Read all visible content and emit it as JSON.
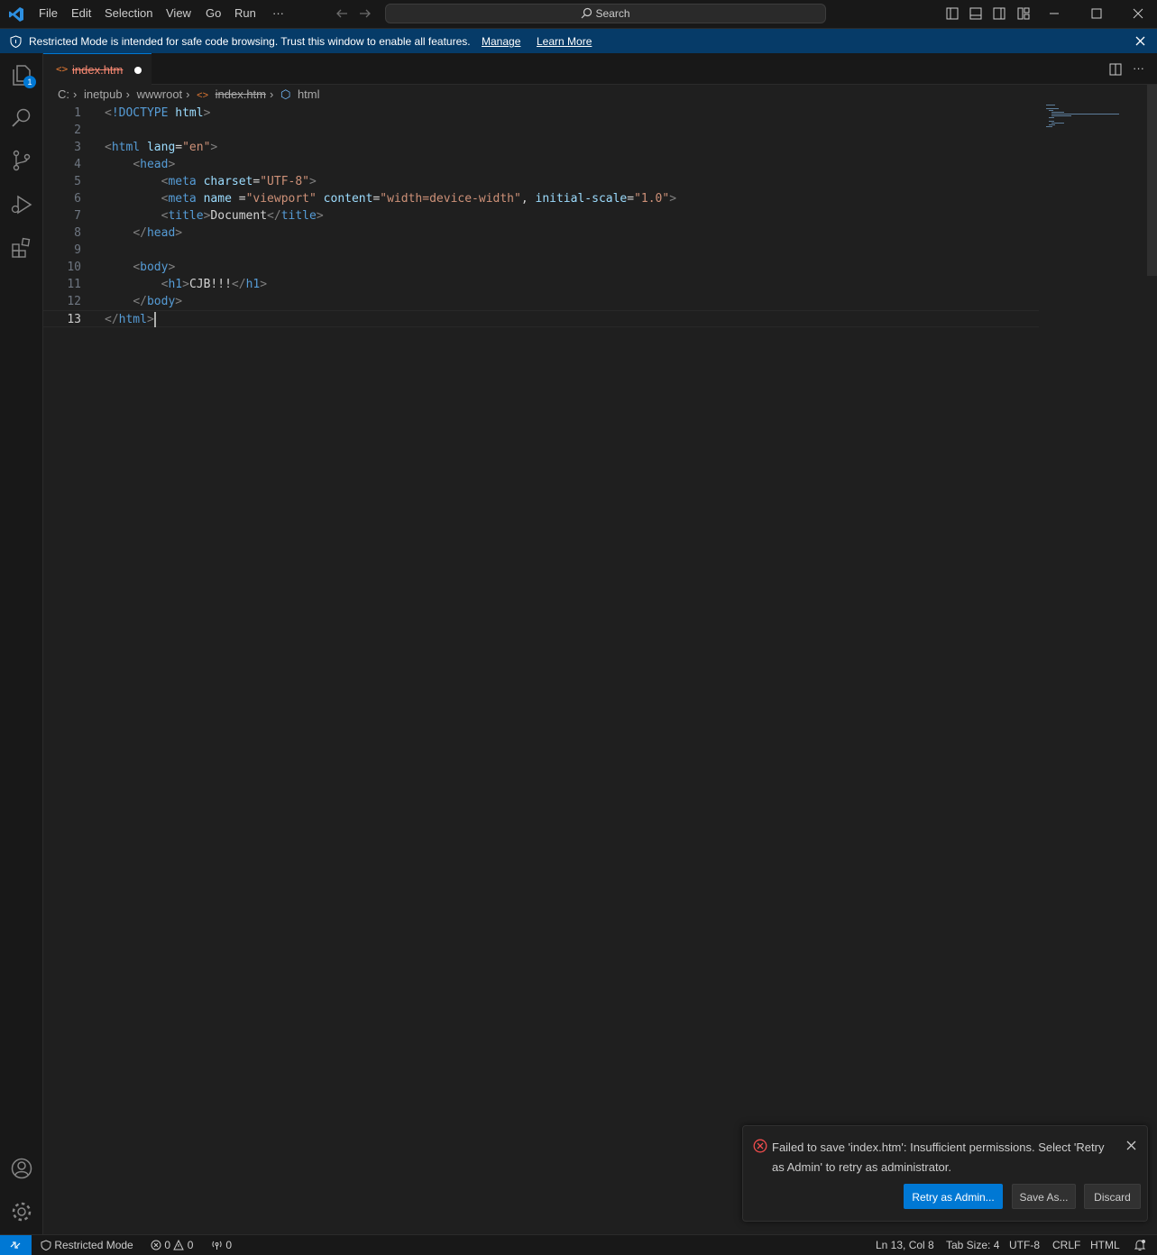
{
  "menu": {
    "file": "File",
    "edit": "Edit",
    "selection": "Selection",
    "view": "View",
    "go": "Go",
    "run": "Run",
    "more": "···"
  },
  "search": {
    "label": "Search"
  },
  "banner": {
    "message": "Restricted Mode is intended for safe code browsing. Trust this window to enable all features.",
    "manage": "Manage",
    "learn_more": "Learn More"
  },
  "activity": {
    "explorer_badge": "1"
  },
  "tab": {
    "filename": "index.htm"
  },
  "breadcrumb": {
    "drive": "C:",
    "folder1": "inetpub",
    "folder2": "wwwroot",
    "file": "index.htm",
    "symbol": "html"
  },
  "editor": {
    "lines": [
      {
        "n": "1",
        "tokens": [
          [
            "b",
            "<"
          ],
          [
            "t",
            "!DOCTYPE"
          ],
          [
            "x",
            " "
          ],
          [
            "a",
            "html"
          ],
          [
            "b",
            ">"
          ]
        ]
      },
      {
        "n": "2",
        "tokens": []
      },
      {
        "n": "3",
        "tokens": [
          [
            "b",
            "<"
          ],
          [
            "t",
            "html"
          ],
          [
            "x",
            " "
          ],
          [
            "a",
            "lang"
          ],
          [
            "x",
            "="
          ],
          [
            "s",
            "\"en\""
          ],
          [
            "b",
            ">"
          ]
        ]
      },
      {
        "n": "4",
        "tokens": [
          [
            "x",
            "    "
          ],
          [
            "b",
            "<"
          ],
          [
            "t",
            "head"
          ],
          [
            "b",
            ">"
          ]
        ]
      },
      {
        "n": "5",
        "tokens": [
          [
            "x",
            "        "
          ],
          [
            "b",
            "<"
          ],
          [
            "t",
            "meta"
          ],
          [
            "x",
            " "
          ],
          [
            "a",
            "charset"
          ],
          [
            "x",
            "="
          ],
          [
            "s",
            "\"UTF-8\""
          ],
          [
            "b",
            ">"
          ]
        ]
      },
      {
        "n": "6",
        "tokens": [
          [
            "x",
            "        "
          ],
          [
            "b",
            "<"
          ],
          [
            "t",
            "meta"
          ],
          [
            "x",
            " "
          ],
          [
            "a",
            "name"
          ],
          [
            "x",
            " ="
          ],
          [
            "s",
            "\"viewport\""
          ],
          [
            "x",
            " "
          ],
          [
            "a",
            "content"
          ],
          [
            "x",
            "="
          ],
          [
            "s",
            "\"width=device-width\""
          ],
          [
            "x",
            ", "
          ],
          [
            "a",
            "initial-scale"
          ],
          [
            "x",
            "="
          ],
          [
            "s",
            "\"1.0\""
          ],
          [
            "b",
            ">"
          ]
        ]
      },
      {
        "n": "7",
        "tokens": [
          [
            "x",
            "        "
          ],
          [
            "b",
            "<"
          ],
          [
            "t",
            "title"
          ],
          [
            "b",
            ">"
          ],
          [
            "x",
            "Document"
          ],
          [
            "b",
            "</"
          ],
          [
            "t",
            "title"
          ],
          [
            "b",
            ">"
          ]
        ]
      },
      {
        "n": "8",
        "tokens": [
          [
            "x",
            "    "
          ],
          [
            "b",
            "</"
          ],
          [
            "t",
            "head"
          ],
          [
            "b",
            ">"
          ]
        ]
      },
      {
        "n": "9",
        "tokens": []
      },
      {
        "n": "10",
        "tokens": [
          [
            "x",
            "    "
          ],
          [
            "b",
            "<"
          ],
          [
            "t",
            "body"
          ],
          [
            "b",
            ">"
          ]
        ]
      },
      {
        "n": "11",
        "tokens": [
          [
            "x",
            "        "
          ],
          [
            "b",
            "<"
          ],
          [
            "t",
            "h1"
          ],
          [
            "b",
            ">"
          ],
          [
            "x",
            "CJB!!!"
          ],
          [
            "b",
            "</"
          ],
          [
            "t",
            "h1"
          ],
          [
            "b",
            ">"
          ]
        ]
      },
      {
        "n": "12",
        "tokens": [
          [
            "x",
            "    "
          ],
          [
            "b",
            "</"
          ],
          [
            "t",
            "body"
          ],
          [
            "b",
            ">"
          ]
        ]
      },
      {
        "n": "13",
        "tokens": [
          [
            "b",
            "</"
          ],
          [
            "t",
            "html"
          ],
          [
            "b",
            ">"
          ]
        ]
      }
    ]
  },
  "notification": {
    "message": "Failed to save 'index.htm': Insufficient permissions. Select 'Retry as Admin' to retry as administrator.",
    "retry": "Retry as Admin...",
    "save_as": "Save As...",
    "discard": "Discard"
  },
  "status": {
    "restricted": "Restricted Mode",
    "errors": "0",
    "warnings": "0",
    "ports": "0",
    "position": "Ln 13, Col 8",
    "tab_size": "Tab Size: 4",
    "encoding": "UTF-8",
    "eol": "CRLF",
    "language": "HTML"
  },
  "colors": {
    "accent": "#0078d4",
    "banner_bg": "#063b68",
    "error": "#f14c4c",
    "tab_modified": "#f48771"
  }
}
